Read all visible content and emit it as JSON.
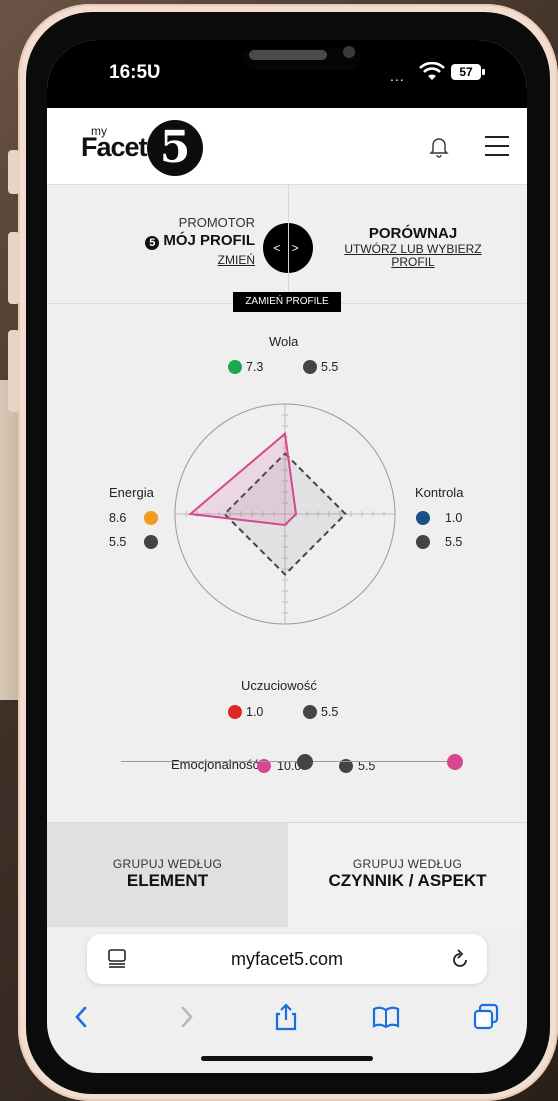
{
  "status": {
    "time": "16:5Ʋ",
    "signal": "...",
    "battery": "57"
  },
  "header": {
    "logo_my": "my",
    "logo_facet": "Facet",
    "logo_digit": "5",
    "bell_icon": "bell-icon",
    "menu_icon": "hamburger-menu-icon"
  },
  "profiles": {
    "promotor_label": "PROMOTOR",
    "my_profile": "MÓJ PROFIL",
    "change": "ZMIEŃ",
    "swap_arrows": "< >",
    "compare_title": "PORÓWNAJ",
    "compare_link": "UTWÓRZ LUB WYBIERZ PROFIL",
    "swap_profiles": "ZAMIEŃ PROFILE"
  },
  "chart_data": {
    "type": "radar",
    "axes": [
      "Wola",
      "Kontrola",
      "Uczuciowość",
      "Energia"
    ],
    "range": [
      0,
      10
    ],
    "series": [
      {
        "values": [
          7.3,
          1.0,
          1.0,
          8.6
        ],
        "color": "#d6478f"
      },
      {
        "values": [
          5.5,
          5.5,
          5.5,
          5.5
        ],
        "color": "#444444"
      }
    ],
    "axis_colors": {
      "Wola": "#1fa84f",
      "Kontrola": "#1a4f8a",
      "Uczuciowość": "#e02626",
      "Energia": "#f39b1c"
    },
    "extra": {
      "label": "Emocjonalność",
      "value": 10.0,
      "compare": 5.5,
      "color": "#d6478f"
    }
  },
  "labels": {
    "wola": "Wola",
    "wola_v1": "7.3",
    "wola_v2": "5.5",
    "kontrola": "Kontrola",
    "kontrola_v1": "1.0",
    "kontrola_v2": "5.5",
    "uczuciowosc": "Uczuciowość",
    "uczuciowosc_v1": "1.0",
    "uczuciowosc_v2": "5.5",
    "energia": "Energia",
    "energia_v1": "8.6",
    "energia_v2": "5.5",
    "emocjonalnosc": "Emocjonalność",
    "emocjonalnosc_v1": "10.0",
    "emocjonalnosc_v2": "5.5"
  },
  "groupby": {
    "left_sub": "GRUPUJ WEDŁUG",
    "left_main": "ELEMENT",
    "right_sub": "GRUPUJ WEDŁUG",
    "right_main": "CZYNNIK / ASPEKT"
  },
  "browser": {
    "url": "myfacet5.com"
  }
}
